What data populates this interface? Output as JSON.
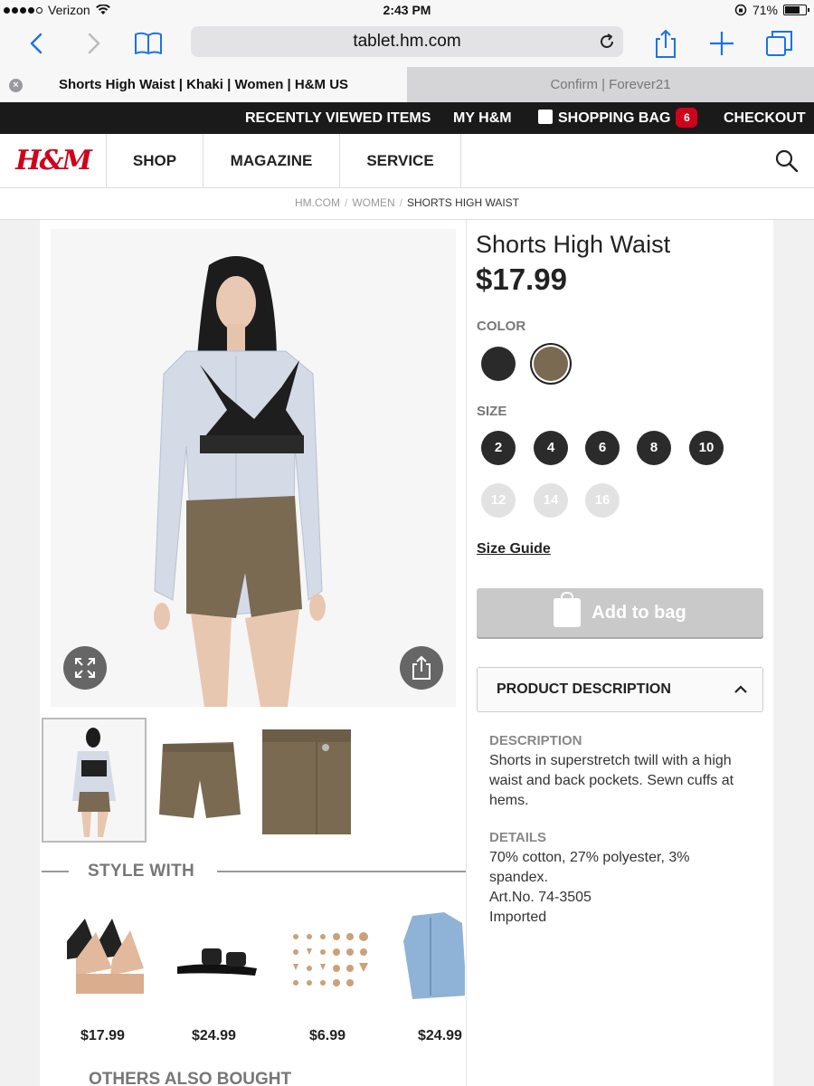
{
  "status_bar": {
    "carrier": "Verizon",
    "time": "2:43 PM",
    "battery": "71%"
  },
  "browser": {
    "url": "tablet.hm.com",
    "tabs": [
      {
        "label": "Shorts High Waist | Khaki | Women | H&M US",
        "active": true
      },
      {
        "label": "Confirm | Forever21",
        "active": false
      }
    ]
  },
  "top_nav": {
    "recently_viewed": "RECENTLY VIEWED ITEMS",
    "my_hm": "MY H&M",
    "shopping_bag": "SHOPPING BAG",
    "bag_count": "6",
    "checkout": "CHECKOUT"
  },
  "main_nav": {
    "logo": "H&M",
    "links": [
      "SHOP",
      "MAGAZINE",
      "SERVICE"
    ]
  },
  "breadcrumb": [
    "HM.COM",
    "WOMEN",
    "SHORTS HIGH WAIST"
  ],
  "product": {
    "title": "Shorts High Waist",
    "price": "$17.99",
    "color_label": "COLOR",
    "colors": [
      {
        "name": "black",
        "hex": "#2a2a2a",
        "selected": false
      },
      {
        "name": "khaki",
        "hex": "#7a6a52",
        "selected": true
      }
    ],
    "size_label": "SIZE",
    "sizes_available": [
      "2",
      "4",
      "6",
      "8",
      "10"
    ],
    "sizes_unavailable": [
      "12",
      "14",
      "16"
    ],
    "size_guide": "Size Guide",
    "add_to_bag": "Add to bag",
    "description_header": "PRODUCT DESCRIPTION",
    "description_label": "DESCRIPTION",
    "description_text": "Shorts in superstretch twill with a high waist and back pockets. Sewn cuffs at hems.",
    "details_label": "DETAILS",
    "details_lines": [
      "70% cotton, 27% polyester, 3% spandex.",
      "Art.No. 74-3505",
      "Imported"
    ]
  },
  "style_with": {
    "label": "STYLE WITH",
    "items": [
      {
        "name": "bralettes",
        "price": "$17.99"
      },
      {
        "name": "slide-sandals",
        "price": "$24.99"
      },
      {
        "name": "earrings-set",
        "price": "$6.99"
      },
      {
        "name": "denim-jacket",
        "price": "$24.99"
      }
    ]
  },
  "others_label": "OTHERS ALSO BOUGHT",
  "colors": {
    "brand_red": "#d0021b",
    "safari_blue": "#1a73e8"
  }
}
